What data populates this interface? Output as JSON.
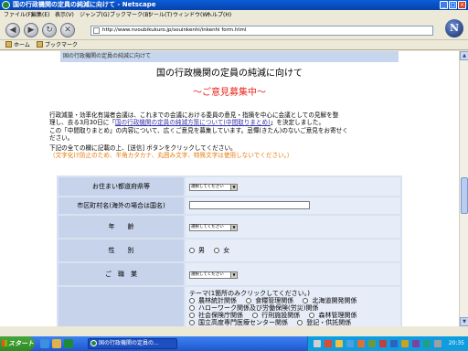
{
  "window": {
    "title": "国の行政機関の定員の純減に向けて - Netscape"
  },
  "menu": [
    "ファイル(F)",
    "編集(E)",
    "表示(V)",
    "ジャンプ(G)",
    "ブックマーク(B)",
    "ツール(T)",
    "ウィンドウ(W)",
    "ヘルプ(H)"
  ],
  "nav": {
    "url": "http://www.nvoubikukuro.jp/souinkenhi/inkenhi form.html"
  },
  "personal_bar": {
    "home": "ホーム",
    "bookmarks": "ブックマーク"
  },
  "page": {
    "breadcrumb": "国の行政機関の定員の純減に向けて",
    "title": "国の行政機関の定員の純減に向けて",
    "subtitle": "～ご意見募集中～",
    "intro1_line1": "行政減量・効率化有識者会議は、これまでの会議における委員の意見・指摘を中心に会議としての見解を整",
    "intro1_line2_pre": "理し、去る3月30日に「",
    "intro1_link": "国の行政機関の定員の純減方策について(中間取りまとめ)",
    "intro1_line2_post": "」を決定しました。",
    "intro2_line1": "この「中間取りまとめ」の内容について、広くご意見を募集しています。忌憚(きたん)のないご意見をお寄せく",
    "intro2_line2": "ださい。",
    "instruction": "下記の全ての欄に記載の上、[送信] ボタンをクリックしてください。",
    "warning": "（文字化け防止のため、半角カタカナ、丸囲み文字、特殊文字は使用しないでください。）"
  },
  "form": {
    "prefecture_label": "お住まい都道府県等",
    "prefecture_select": "選択してください",
    "city_label": "市区町村名(海外の場合は国名)",
    "age_label": "年　　齢",
    "age_select": "選択してください",
    "gender_label": "性　　別",
    "male": "男",
    "female": "女",
    "occupation_label": "ご　職　業",
    "occupation_select": "選択してください",
    "theme_heading": "テーマ(1箇所のみクリックしてください。)",
    "themes_row1": [
      "農林統計関係",
      "食糧管理関係",
      "北海道開発関係"
    ],
    "themes_row2": [
      "ハローワーク関係及び労働保険(労災)関係"
    ],
    "themes_row3": [
      "社会保険庁関係",
      "行刑施設関係",
      "森林管理関係"
    ],
    "themes_row4": [
      "国立高度専門医療センター関係",
      "登記・供託関係"
    ]
  },
  "taskbar": {
    "start": "スタート",
    "task_label": "国の行政機関の定員の...",
    "clock": "20:35"
  }
}
